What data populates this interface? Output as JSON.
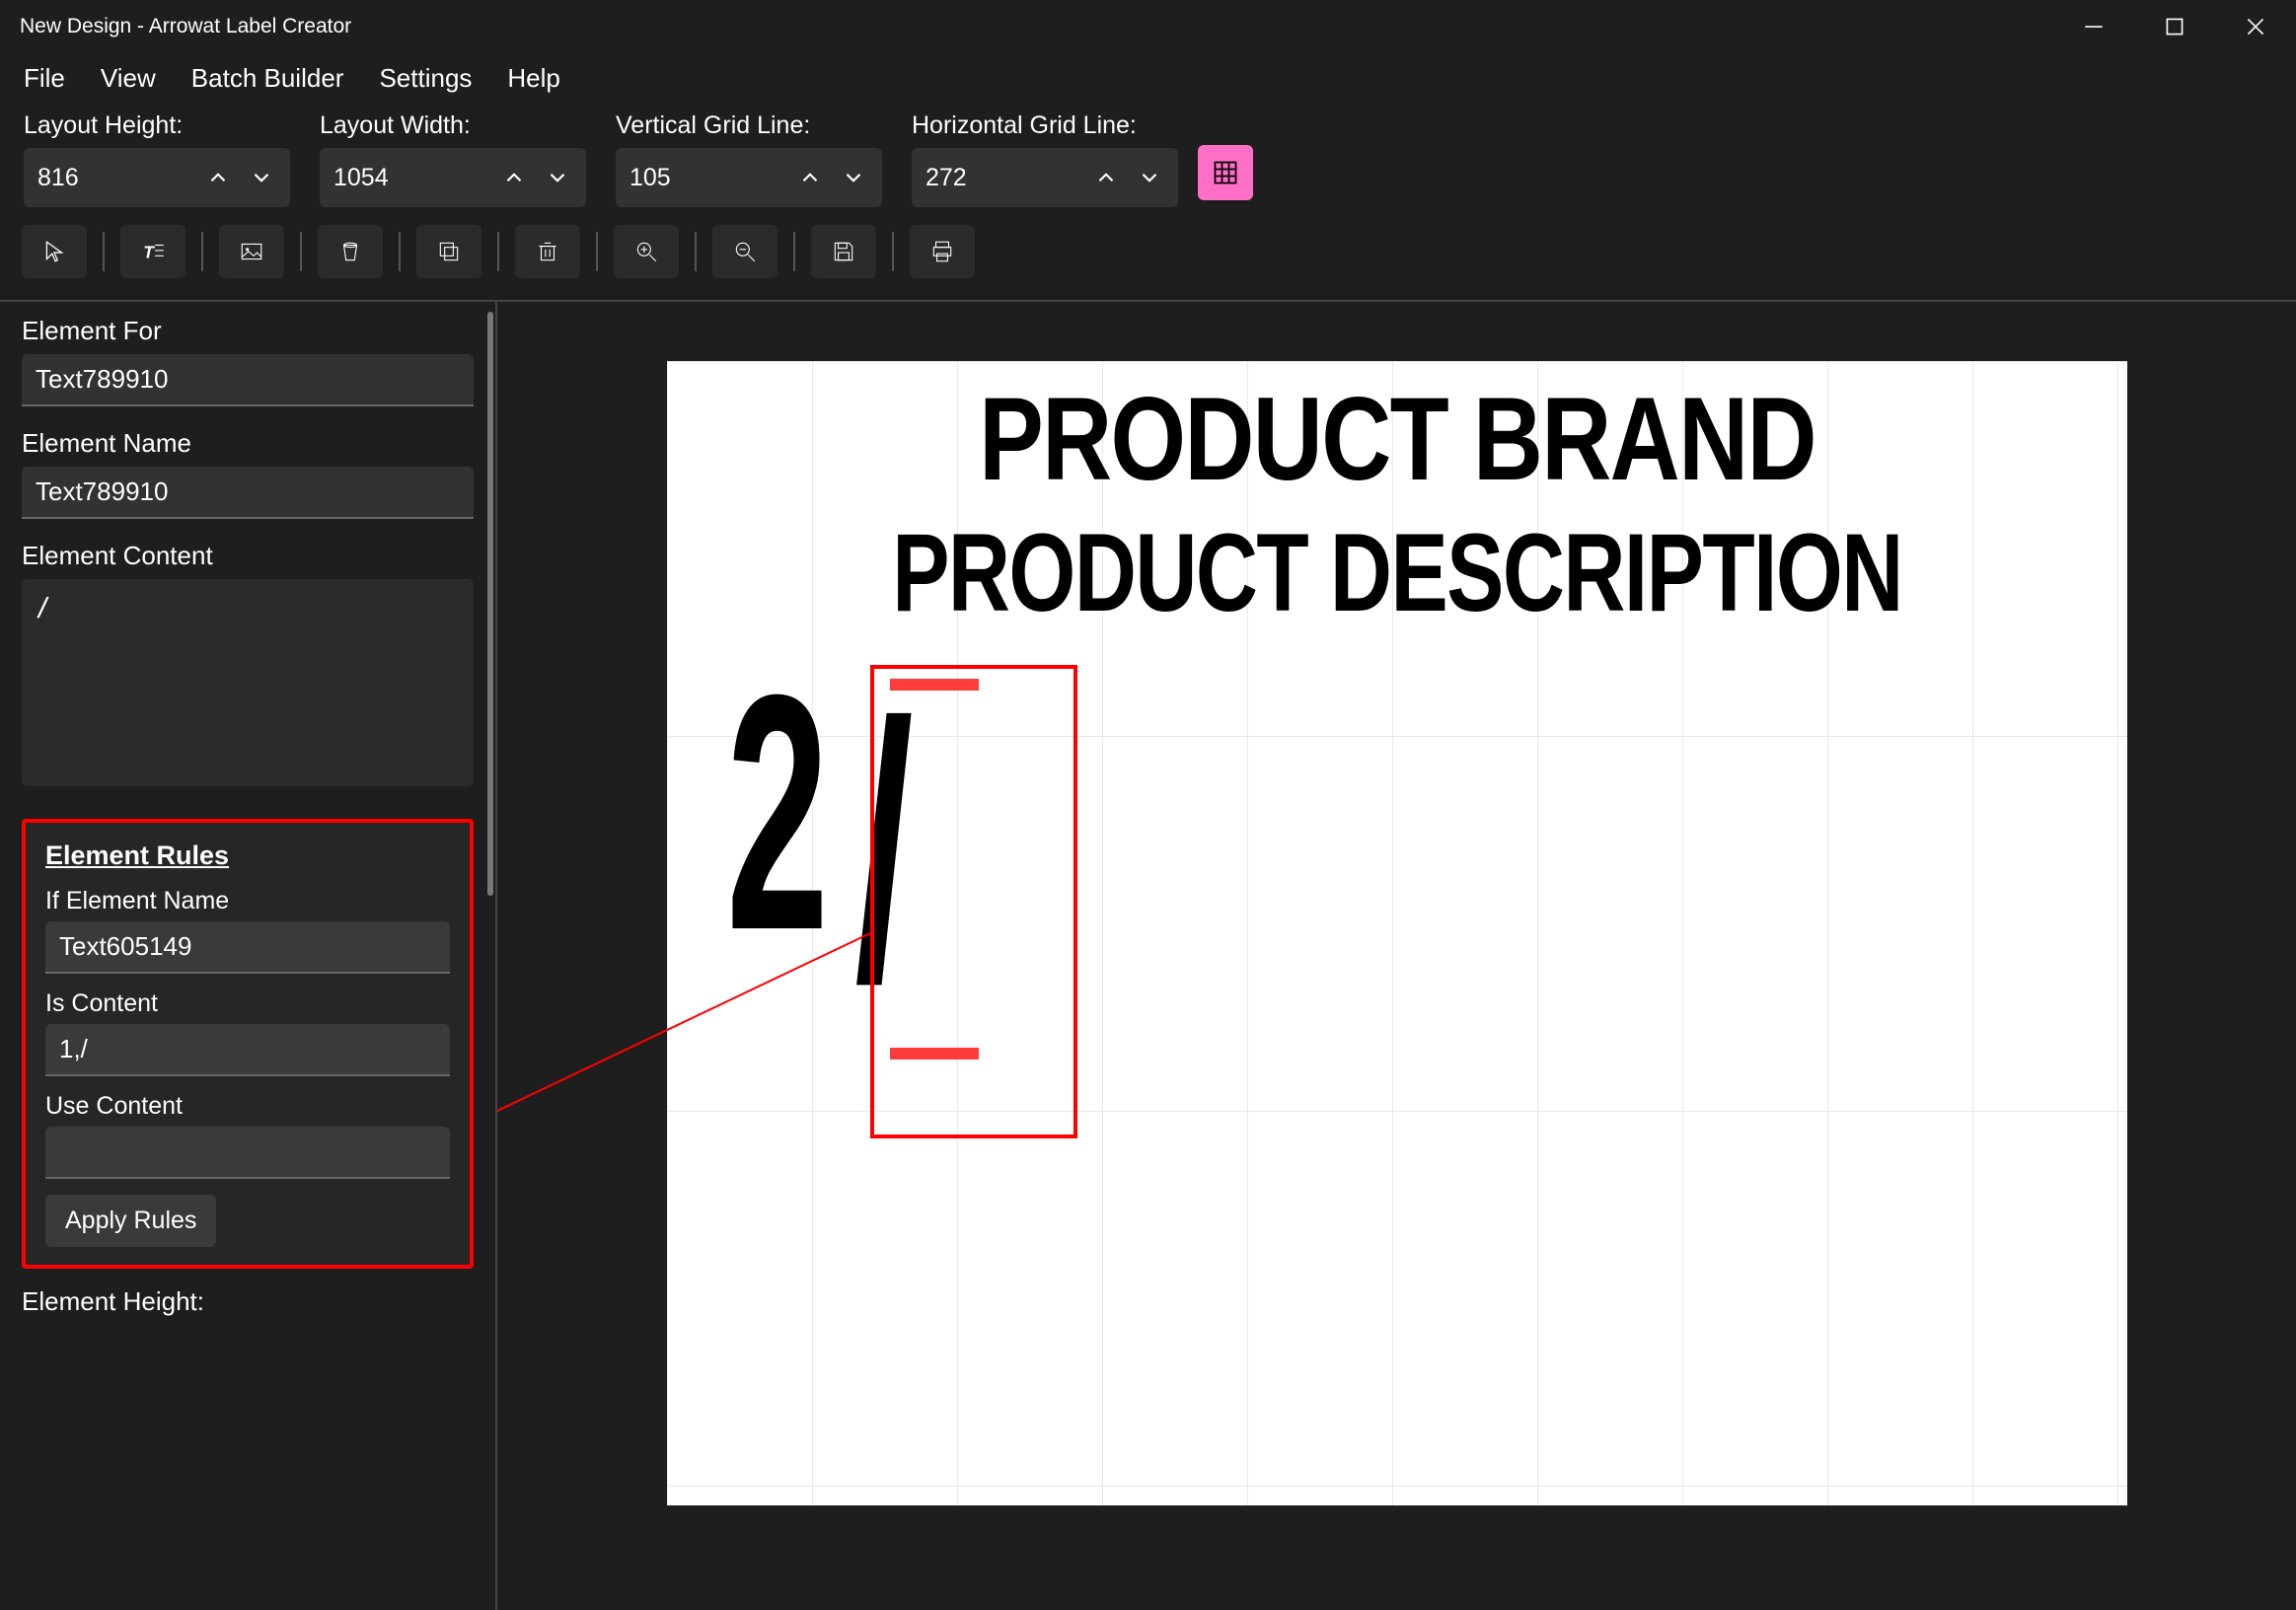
{
  "titlebar": {
    "title": "New Design - Arrowat Label Creator"
  },
  "menubar": {
    "items": [
      "File",
      "View",
      "Batch Builder",
      "Settings",
      "Help"
    ]
  },
  "params": {
    "layout_height": {
      "label": "Layout Height:",
      "value": "816"
    },
    "layout_width": {
      "label": "Layout Width:",
      "value": "1054"
    },
    "vgrid": {
      "label": "Vertical Grid Line:",
      "value": "105"
    },
    "hgrid": {
      "label": "Horizontal Grid Line:",
      "value": "272"
    }
  },
  "sidebar": {
    "element_for": {
      "label": "Element For",
      "value": "Text789910"
    },
    "element_name": {
      "label": "Element Name",
      "value": "Text789910"
    },
    "element_content": {
      "label": "Element Content",
      "value": "/"
    },
    "rules": {
      "title": "Element Rules",
      "if_element_name": {
        "label": "If Element Name",
        "value": "Text605149"
      },
      "is_content": {
        "label": "Is Content",
        "value": "1,/"
      },
      "use_content": {
        "label": "Use Content",
        "value": ""
      },
      "apply": "Apply Rules"
    },
    "element_height": {
      "label": "Element Height:"
    }
  },
  "canvas": {
    "brand": "PRODUCT BRAND",
    "description": "PRODUCT DESCRIPTION",
    "qty": "2",
    "slash": "/"
  },
  "icons": {
    "cursor": "cursor-icon",
    "text": "text-icon",
    "image": "image-icon",
    "bucket": "bucket-icon",
    "copy": "copy-icon",
    "trash": "trash-icon",
    "zoomin": "zoom-in-icon",
    "zoomout": "zoom-out-icon",
    "save": "save-icon",
    "print": "print-icon",
    "grid": "grid-icon"
  }
}
